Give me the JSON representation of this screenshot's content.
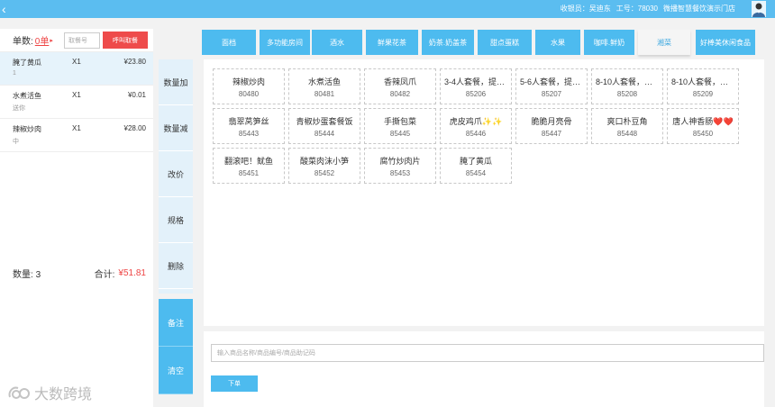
{
  "topbar": {
    "back_icon": "‹",
    "cashier_label": "收银员：",
    "cashier_name": "吴迪东",
    "jobno_label": "工号",
    "jobno": "78030",
    "store": "微播智慧餐饮演示门店",
    "avatar_icon": "user-avatar-icon"
  },
  "order": {
    "count_label": "单数:",
    "count_value": "0单",
    "arrow": "▸",
    "table_placeholder": "取餐号",
    "call_button": "呼叫取餐",
    "items": [
      {
        "name": "腌了黄瓜",
        "qty": "X1",
        "price": "¥23.80",
        "sub": "1"
      },
      {
        "name": "水煮活鱼",
        "qty": "X1",
        "price": "¥0.01",
        "sub": "送你"
      },
      {
        "name": "辣椒炒肉",
        "qty": "X1",
        "price": "¥28.00",
        "sub": "中"
      }
    ],
    "footer_qty_label": "数量:",
    "footer_qty": "3",
    "footer_total_label": "合计:",
    "footer_total": "¥51.81"
  },
  "actions": [
    "数量加",
    "数量减",
    "改价",
    "规格",
    "删除"
  ],
  "actions2": [
    "备注",
    "清空"
  ],
  "tabs": [
    {
      "label": "面档",
      "active": false
    },
    {
      "label": "多功能房间",
      "active": false
    },
    {
      "label": "酒水",
      "active": false
    },
    {
      "label": "鲜果花茶",
      "active": false
    },
    {
      "label": "奶茶.奶盖茶",
      "active": false
    },
    {
      "label": "甜点蛋糕",
      "active": false
    },
    {
      "label": "水果",
      "active": false
    },
    {
      "label": "咖啡.鲜奶",
      "active": false
    },
    {
      "label": "湘菜",
      "active": true
    },
    {
      "label": "好棒美休闲食品",
      "active": false
    }
  ],
  "products": [
    {
      "name": "辣椒炒肉",
      "code": "80480"
    },
    {
      "name": "水煮活鱼",
      "code": "80481"
    },
    {
      "name": "香辣凤爪",
      "code": "80482"
    },
    {
      "name": "3-4人套餐，提前预定",
      "code": "85206"
    },
    {
      "name": "5-6人套餐，提前预定",
      "code": "85207"
    },
    {
      "name": "8-10人套餐，提前预定",
      "code": "85208"
    },
    {
      "name": "8-10人套餐，提前预定",
      "code": "85209"
    },
    {
      "name": "翡翠莴笋丝",
      "code": "85443"
    },
    {
      "name": "青椒炒蛋套餐饭",
      "code": "85444"
    },
    {
      "name": "手撕包菜",
      "code": "85445"
    },
    {
      "name": "虎皮鸡爪✨✨",
      "code": "85446"
    },
    {
      "name": "脆脆月亮骨",
      "code": "85447"
    },
    {
      "name": "爽口朴豆角",
      "code": "85448"
    },
    {
      "name": "唐人神香肠❤️❤️",
      "code": "85450"
    },
    {
      "name": "翻滚吧！鱿鱼",
      "code": "85451"
    },
    {
      "name": "酸菜肉沫小笋",
      "code": "85452"
    },
    {
      "name": "腐竹炒肉片",
      "code": "85453"
    },
    {
      "name": "腌了黄瓜",
      "code": "85454"
    }
  ],
  "search": {
    "placeholder": "输入商品名称/商品编号/商品助记码"
  },
  "order_button": "下单",
  "watermark": {
    "text": "大数跨境"
  }
}
